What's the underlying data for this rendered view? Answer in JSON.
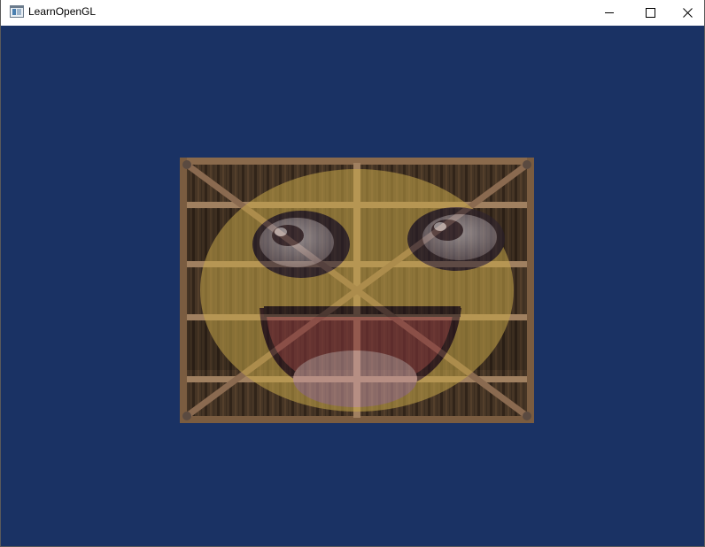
{
  "window": {
    "title": "LearnOpenGL",
    "clear_color": "#1a3264"
  },
  "titlebar": {
    "icon": "window-app-icon",
    "controls": [
      "minimize-icon",
      "maximize-icon",
      "close-icon"
    ]
  },
  "scene": {
    "object": "textured-quad",
    "textures": [
      "wooden-container",
      "awesome-face"
    ],
    "colors": {
      "wood_frame": "#8a6a4c",
      "wood_plank_dark": "#3a2a22",
      "face_yellow": "#c8a84a",
      "mouth_red": "#8a3a40",
      "tongue_pink": "#c89aa0"
    }
  }
}
